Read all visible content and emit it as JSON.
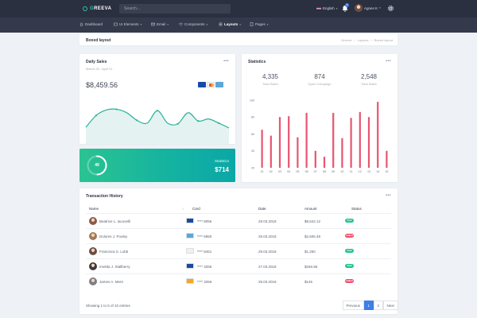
{
  "topbar": {
    "brand_letter": "G",
    "brand_rest": "REEVA",
    "search_placeholder": "Search...",
    "language": "English",
    "notifications_count": "3",
    "user_name": "Agnes K"
  },
  "nav": [
    {
      "label": "Dashboard",
      "icon": "home-icon"
    },
    {
      "label": "UI Elements",
      "icon": "layers-icon"
    },
    {
      "label": "Email",
      "icon": "mail-icon"
    },
    {
      "label": "Components",
      "icon": "heart-icon"
    },
    {
      "label": "Layouts",
      "icon": "layout-icon"
    },
    {
      "label": "Pages",
      "icon": "pages-icon"
    }
  ],
  "page": {
    "title": "Boxed layout",
    "breadcrumb": [
      "Greeva",
      "Layouts",
      "Boxed layout"
    ]
  },
  "daily_sales": {
    "title": "Daily Sales",
    "subtitle": "March 26 - April 01",
    "amount": "$8,459.56"
  },
  "sales_chart": {
    "type": "area",
    "values": [
      2.4,
      4.1,
      4.9,
      5.0,
      4.5,
      3.4,
      3.0,
      4.8,
      3.0,
      2.9,
      4.5,
      3.3,
      3.6,
      3.0,
      2.3
    ],
    "ylim": [
      0,
      7
    ],
    "color": "#27b39a"
  },
  "statistics": {
    "title": "Statistics",
    "stats": [
      {
        "value": "4,335",
        "label": "Total Sales"
      },
      {
        "value": "874",
        "label": "Open Compaign"
      },
      {
        "value": "2,548",
        "label": "Total Sales"
      }
    ]
  },
  "chart_data": {
    "type": "bar",
    "categories": [
      "01",
      "02",
      "03",
      "04",
      "05",
      "06",
      "07",
      "08",
      "09",
      "10",
      "11",
      "12",
      "13",
      "14",
      "15"
    ],
    "values": [
      65,
      58,
      80,
      81,
      56,
      85,
      40,
      33,
      85,
      55,
      79,
      86,
      80,
      98,
      40
    ],
    "title": "",
    "xlabel": "",
    "ylabel": "",
    "ylim": [
      20,
      100
    ],
    "yticks": [
      20,
      40,
      60,
      80,
      100
    ],
    "grid": false,
    "color": "#e8546f"
  },
  "widget": {
    "ring_value": "49",
    "ring_fraction": 0.49,
    "label": "Statistics",
    "value": "$714"
  },
  "transactions": {
    "title": "Transaction History",
    "columns": [
      "Name",
      "Card",
      "Date",
      "Amount",
      "Status"
    ],
    "rows": [
      {
        "name": "Beatrice L. Iacovelli",
        "card": "**** 8056",
        "date": "29.03.2018",
        "amount": "$8,642.12",
        "status": "Paid",
        "card_type": "visa",
        "avatar": "#8a5a4a"
      },
      {
        "name": "Dolores J. Pooley",
        "card": "**** 6950",
        "date": "29.03.2018",
        "amount": "$2,605.48",
        "status": "Failed",
        "card_type": "amex",
        "avatar": "#a07a5c"
      },
      {
        "name": "Francisca S. Lobb",
        "card": "**** 8451",
        "date": "29.03.2018",
        "amount": "$1,250",
        "status": "Paid",
        "card_type": "mastercard",
        "avatar": "#6a4e44"
      },
      {
        "name": "Imelda J. Stallberry",
        "card": "**** 3256",
        "date": "27.03.2018",
        "amount": "$346.86",
        "status": "Paid",
        "card_type": "visa",
        "avatar": "#3b3b40"
      },
      {
        "name": "James A. Ment",
        "card": "**** 3256",
        "date": "29.03.2018",
        "amount": "$146",
        "status": "Failed",
        "card_type": "discover",
        "avatar": "#7c7e84"
      }
    ],
    "showing": "Showing 1 to 5 of 10 entries",
    "pagination": {
      "previous": "Previous",
      "pages": [
        "1",
        "2"
      ],
      "next": "Next"
    }
  },
  "colors": {
    "accent": "#3f7ee8",
    "paid": "#22c38e",
    "failed": "#f0506e",
    "topbar": "#2b3040",
    "navbar": "#343a4b"
  }
}
